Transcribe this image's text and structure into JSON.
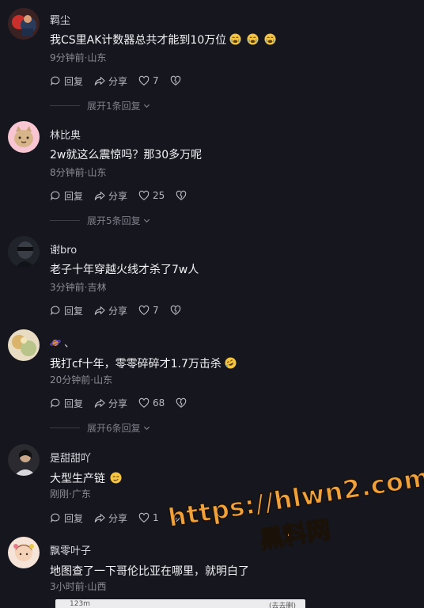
{
  "comments": [
    {
      "username": "羁尘",
      "content": "我CS里AK计数器总共才能到10万位",
      "emoji_count": 3,
      "emoji": "crying-sweat-emoji",
      "time_location": "9分钟前·山东",
      "reply_label": "回复",
      "share_label": "分享",
      "likes": "7",
      "expand_label": "展开1条回复"
    },
    {
      "username": "林比奥",
      "content": "2w就这么震惊吗？那30多万呢",
      "time_location": "8分钟前·山东",
      "reply_label": "回复",
      "share_label": "分享",
      "likes": "25",
      "expand_label": "展开5条回复"
    },
    {
      "username": "谢bro",
      "content": "老子十年穿越火线才杀了7w人",
      "time_location": "3分钟前·吉林",
      "reply_label": "回复",
      "share_label": "分享",
      "likes": "7"
    },
    {
      "username": "、",
      "username_icon": "planet-icon",
      "content": "我打cf十年，零零碎碎才1.7万击杀",
      "emoji": "rofl-emoji",
      "time_location": "20分钟前·山东",
      "reply_label": "回复",
      "share_label": "分享",
      "likes": "68",
      "expand_label": "展开6条回复"
    },
    {
      "username": "是甜甜吖",
      "content": "大型生产链",
      "emoji": "smirk-emoji",
      "time_location": "刚刚·广东",
      "reply_label": "回复",
      "share_label": "分享",
      "likes": "1"
    },
    {
      "username": "飘零叶子",
      "content": "地图查了一下哥伦比亚在哪里，就明白了",
      "time_location": "3小时前·山西"
    }
  ],
  "watermark": {
    "url": "https://hlwn2.com",
    "name": "黑料网"
  },
  "bottom_bar": {
    "left_text": "123m",
    "right_text": "(去去删)"
  },
  "colors": {
    "background": "#16161e",
    "watermark": "#f0a13a"
  }
}
